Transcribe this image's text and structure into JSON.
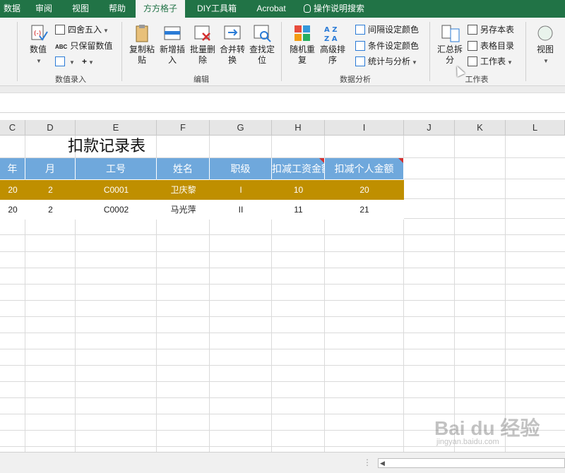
{
  "tabs": [
    "数据",
    "审阅",
    "视图",
    "帮助",
    "方方格子",
    "DIY工具箱",
    "Acrobat",
    "操作说明搜索"
  ],
  "ribbon": {
    "group_input_label": "数值录入",
    "group_edit_label": "编辑",
    "group_analysis_label": "数据分析",
    "group_sheet_label": "工作表",
    "btn_value": "数值",
    "btn_round": "四舍五入",
    "btn_keep_value": "只保留数值",
    "btn_copy_paste": "复制粘贴",
    "btn_new_insert": "新增插入",
    "btn_batch_delete": "批量删除",
    "btn_merge_convert": "合并转换",
    "btn_find_locate": "查找定位",
    "btn_random_repeat": "随机重复",
    "btn_advanced_sort": "高级排序",
    "btn_interval_color": "间隔设定颜色",
    "btn_condition_color": "条件设定颜色",
    "btn_stats_analysis": "统计与分析",
    "btn_summary_split": "汇总拆分",
    "btn_save_sheet": "另存本表",
    "btn_sheet_index": "表格目录",
    "btn_worksheet": "工作表",
    "btn_view": "视图"
  },
  "columns": [
    "C",
    "D",
    "E",
    "F",
    "G",
    "H",
    "I",
    "J",
    "K",
    "L"
  ],
  "sheet_title": "扣款记录表",
  "table": {
    "headers": [
      "年",
      "月",
      "工号",
      "姓名",
      "职级",
      "扣减工资金额",
      "扣减个人金额"
    ],
    "rows": [
      [
        "20",
        "2",
        "C0001",
        "卫庆黎",
        "I",
        "10",
        "20"
      ],
      [
        "20",
        "2",
        "C0002",
        "马光萍",
        "II",
        "11",
        "21"
      ]
    ]
  },
  "colors": {
    "ribbon_green": "#217346",
    "header_blue": "#6fa8dc",
    "highlight_row": "#bf8f00",
    "comment_red": "#d32f2f"
  },
  "watermark": {
    "brand": "Bai du 经验",
    "url": "jingyan.baidu.com"
  }
}
